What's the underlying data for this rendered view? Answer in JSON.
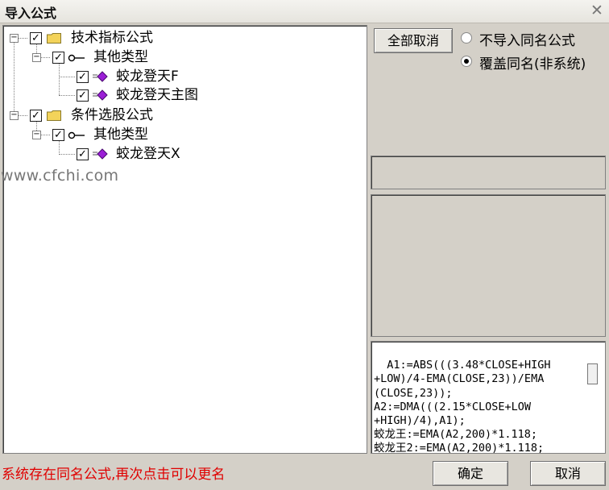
{
  "window": {
    "title": "导入公式"
  },
  "tree": {
    "groups": [
      {
        "label": "技术指标公式",
        "checked": true,
        "subgroup": {
          "label": "其他类型",
          "checked": true,
          "items": [
            {
              "label": "蛟龙登天F",
              "checked": true
            },
            {
              "label": "蛟龙登天主图",
              "checked": true
            }
          ]
        }
      },
      {
        "label": "条件选股公式",
        "checked": true,
        "subgroup": {
          "label": "其他类型",
          "checked": true,
          "items": [
            {
              "label": "蛟龙登天X",
              "checked": true
            }
          ]
        }
      }
    ]
  },
  "watermark": "www.cfchi.com",
  "options": {
    "cancel_all_label": "全部取消",
    "radio_no_import": "不导入同名公式",
    "radio_overwrite": "覆盖同名(非系统)",
    "selected": "overwrite"
  },
  "formula_preview": "A1:=ABS(((3.48*CLOSE+HIGH\n+LOW)/4-EMA(CLOSE,23))/EMA\n(CLOSE,23));\nA2:=DMA(((2.15*CLOSE+LOW\n+HIGH)/4),A1);\n蛟龙王:=EMA(A2,200)*1.118;\n蛟龙王2:=EMA(A2,200)*1.118;",
  "status_message": "系统存在同名公式,再次点击可以更名",
  "footer": {
    "ok_label": "确定",
    "cancel_label": "取消"
  },
  "colors": {
    "status_text": "#e00000",
    "gem_icon": "#9b1fd6",
    "folder": "#f3d35a",
    "window_bg": "#d4d0c8"
  }
}
